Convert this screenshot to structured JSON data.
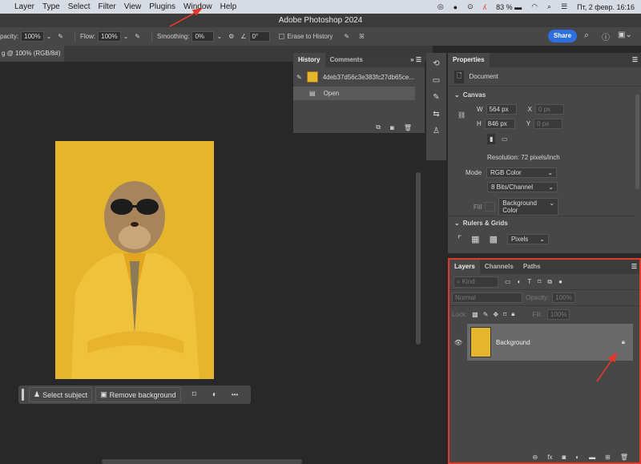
{
  "menubar": {
    "items": [
      "Layer",
      "Type",
      "Select",
      "Filter",
      "View",
      "Plugins",
      "Window",
      "Help"
    ],
    "battery": "83 %",
    "datetime": "Пт, 2 февр.  16:16"
  },
  "titlebar": {
    "title": "Adobe Photoshop 2024"
  },
  "options": {
    "opacity_label": "pacity:",
    "opacity": "100%",
    "flow_label": "Flow:",
    "flow": "100%",
    "smoothing_label": "Smoothing:",
    "smoothing": "0%",
    "angle": "0°",
    "erase_label": "Erase to History",
    "share": "Share"
  },
  "document": {
    "tab": "g @ 100% (RGB/8#)"
  },
  "context_bar": {
    "select_subject": "Select subject",
    "remove_background": "Remove background",
    "more": "•••"
  },
  "history": {
    "tabs": [
      "History",
      "Comments"
    ],
    "snapshot": "4deb37d56c3e383fc27db65ce...",
    "items": [
      "Open"
    ]
  },
  "properties": {
    "title": "Properties",
    "type": "Document",
    "canvas_label": "Canvas",
    "w_label": "W",
    "w": "564 px",
    "h_label": "H",
    "h": "846 px",
    "x_label": "X",
    "x": "0 px",
    "y_label": "Y",
    "y": "0 px",
    "resolution": "Resolution: 72 pixels/inch",
    "mode_label": "Mode",
    "mode": "RGB Color",
    "bits": "8 Bits/Channel",
    "fill_label": "Fill",
    "fill": "Background Color",
    "rulers_label": "Rulers & Grids",
    "units": "Pixels"
  },
  "layers": {
    "tabs": [
      "Layers",
      "Channels",
      "Paths"
    ],
    "kind": "Kind",
    "blend": "Normal",
    "opacity_label": "Opacity:",
    "opacity": "100%",
    "lock_label": "Lock:",
    "fill_label": "Fill:",
    "fill": "100%",
    "items": [
      {
        "name": "Background",
        "locked": true,
        "visible": true
      }
    ]
  },
  "colors": {
    "accent": "#2d6fe0",
    "highlight": "#e03a2a",
    "image_bg": "#e6b52e"
  }
}
